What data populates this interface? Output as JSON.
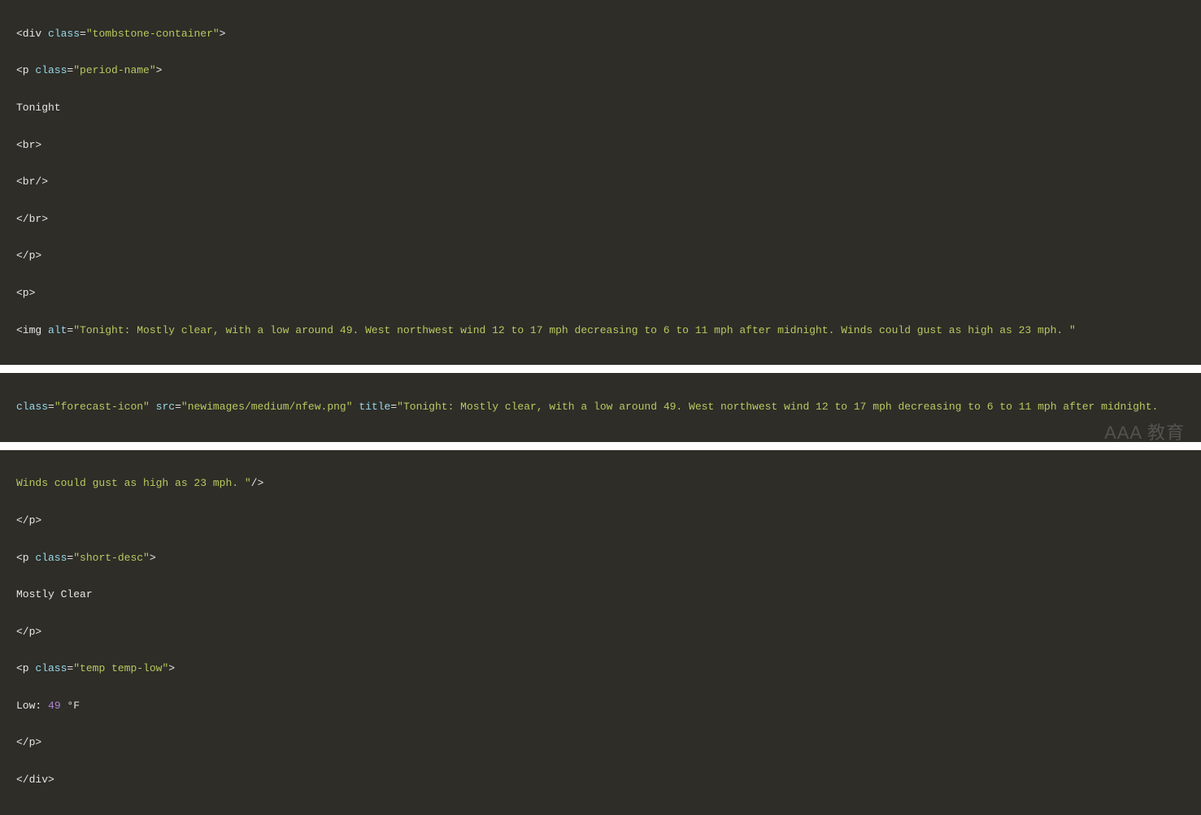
{
  "block1": {
    "l1": {
      "t1": "<div ",
      "a1": "class",
      "e1": "=",
      "s1": "\"tombstone-container\"",
      "t2": ">"
    },
    "l2": {
      "t1": "<p ",
      "a1": "class",
      "e1": "=",
      "s1": "\"period-name\"",
      "t2": ">"
    },
    "l3": {
      "t1": "Tonight"
    },
    "l4": {
      "t1": "<br>"
    },
    "l5": {
      "t1": "<br/>"
    },
    "l6": {
      "t1": "</br>"
    },
    "l7": {
      "t1": "</p>"
    },
    "l8": {
      "t1": "<p>"
    },
    "l9": {
      "t1": "<img ",
      "a1": "alt",
      "e1": "=",
      "s1": "\"Tonight: Mostly clear, with a low around 49. West northwest wind 12 to 17 mph decreasing to 6 to 11 mph after midnight. Winds could gust as high as 23 mph. \""
    }
  },
  "block2": {
    "l1": {
      "a1": "class",
      "e1": "=",
      "s1": "\"forecast-icon\"",
      "sp1": " ",
      "a2": "src",
      "e2": "=",
      "s2": "\"newimages/medium/nfew.png\"",
      "sp2": " ",
      "a3": "title",
      "e3": "=",
      "s3": "\"Tonight: Mostly clear, with a low around 49. West northwest wind 12 to 17 mph decreasing to 6 to 11 mph after midnight."
    }
  },
  "block3": {
    "l1": {
      "s1": "Winds could gust as high as 23 mph. \"",
      "t1": "/>"
    },
    "l2": {
      "t1": "</p>"
    },
    "l3": {
      "t1": "<p ",
      "a1": "class",
      "e1": "=",
      "s1": "\"short-desc\"",
      "t2": ">"
    },
    "l4": {
      "t1": "Mostly Clear"
    },
    "l5": {
      "t1": "</p>"
    },
    "l6": {
      "t1": "<p ",
      "a1": "class",
      "e1": "=",
      "s1": "\"temp temp-low\"",
      "t2": ">"
    },
    "l7": {
      "t1": "Low: ",
      "n1": "49",
      "t2": " °F"
    },
    "l8": {
      "t1": "</p>"
    },
    "l9": {
      "t1": "</div>"
    }
  },
  "watermark": "AAA 教育"
}
